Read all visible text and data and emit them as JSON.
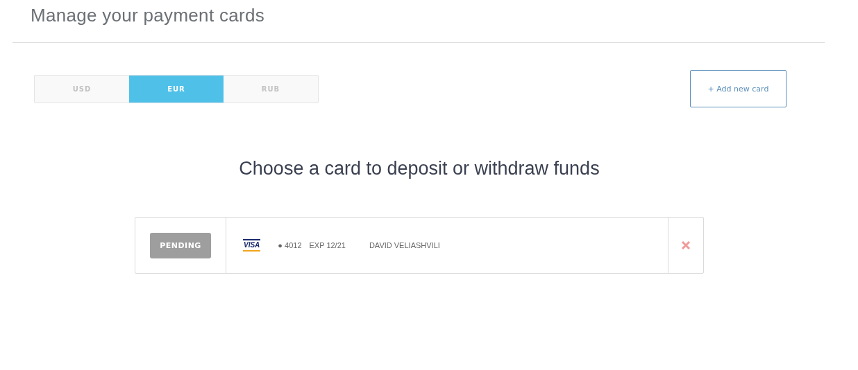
{
  "page_title": "Manage your payment cards",
  "currency_tabs": [
    {
      "label": "USD",
      "selected": false
    },
    {
      "label": "EUR",
      "selected": true
    },
    {
      "label": "RUB",
      "selected": false
    }
  ],
  "add_button": "+ Add new card",
  "heading": "Choose a card to deposit or withdraw funds",
  "cards": [
    {
      "status": "PENDING",
      "brand": "VISA",
      "number": "● 4012",
      "expiry": "EXP 12/21",
      "holder": "DAVID VELIASHVILI"
    }
  ]
}
